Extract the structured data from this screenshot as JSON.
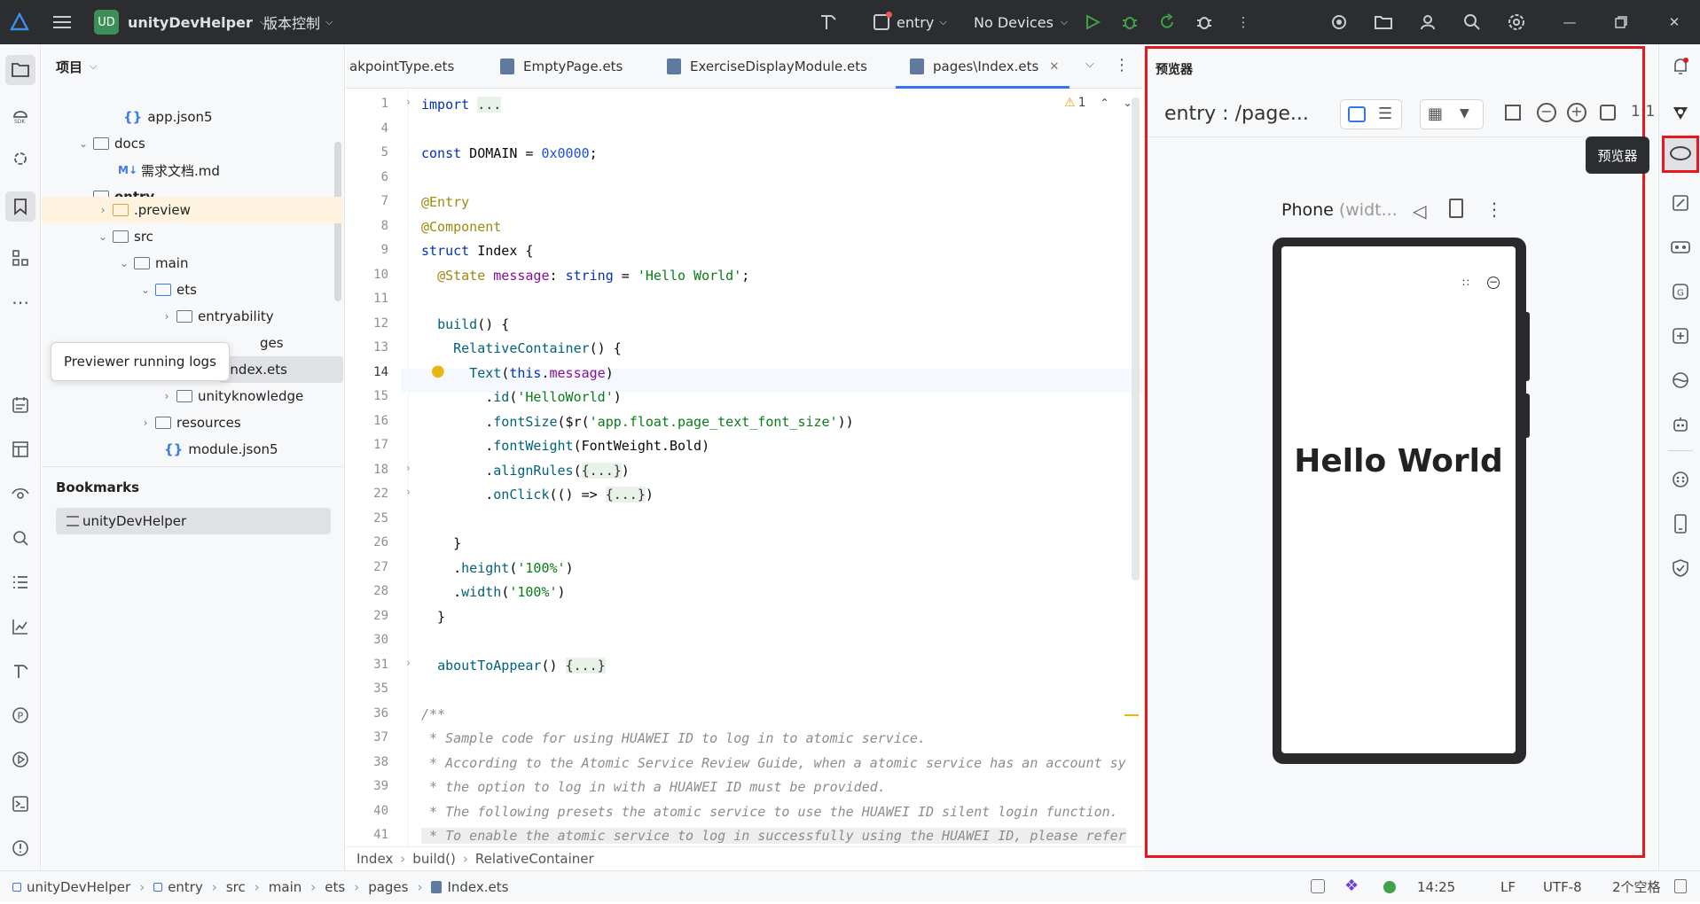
{
  "titlebar": {
    "project_badge": "UD",
    "project_name": "unityDevHelper",
    "vcs_menu": "版本控制",
    "run_config": "entry",
    "devices": "No Devices"
  },
  "project_panel": {
    "title": "项目",
    "tree": [
      {
        "label": "app.json5"
      },
      {
        "label": "docs"
      },
      {
        "label": "需求文档.md",
        "prefix": "M↓"
      },
      {
        "label": "entry"
      },
      {
        "label": ".preview"
      },
      {
        "label": "src"
      },
      {
        "label": "main"
      },
      {
        "label": "ets"
      },
      {
        "label": "entryability"
      },
      {
        "label": "ges"
      },
      {
        "label": "Index.ets"
      },
      {
        "label": "unityknowledge"
      },
      {
        "label": "resources"
      },
      {
        "label": "module.json5"
      }
    ],
    "bookmarks_title": "Bookmarks",
    "bookmark_item": "unityDevHelper",
    "tooltip": "Previewer running logs"
  },
  "tabs": [
    {
      "label": "akpointType.ets"
    },
    {
      "label": "EmptyPage.ets"
    },
    {
      "label": "ExerciseDisplayModule.ets"
    },
    {
      "label": "pages\\Index.ets"
    }
  ],
  "editor": {
    "warning_count": "1",
    "lines": [
      {
        "n": "1"
      },
      {
        "n": "4"
      },
      {
        "n": "5"
      },
      {
        "n": "6"
      },
      {
        "n": "7"
      },
      {
        "n": "8"
      },
      {
        "n": "9"
      },
      {
        "n": "10"
      },
      {
        "n": "11"
      },
      {
        "n": "12"
      },
      {
        "n": "13"
      },
      {
        "n": "14"
      },
      {
        "n": "15"
      },
      {
        "n": "16"
      },
      {
        "n": "17"
      },
      {
        "n": "18"
      },
      {
        "n": "22"
      },
      {
        "n": "25"
      },
      {
        "n": "26"
      },
      {
        "n": "27"
      },
      {
        "n": "28"
      },
      {
        "n": "29"
      },
      {
        "n": "30"
      },
      {
        "n": "31"
      },
      {
        "n": "35"
      },
      {
        "n": "36"
      },
      {
        "n": "37"
      },
      {
        "n": "38"
      },
      {
        "n": "39"
      },
      {
        "n": "40"
      },
      {
        "n": "41"
      }
    ],
    "comments": [
      "/**",
      " * Sample code for using HUAWEI ID to log in to atomic service.",
      " * According to the Atomic Service Review Guide, when a atomic service has an account sy",
      " * the option to log in with a HUAWEI ID must be provided.",
      " * The following presets the atomic service to use the HUAWEI ID silent login function.",
      " * To enable the atomic service to log in successfully using the HUAWEI ID, please refer"
    ]
  },
  "breadcrumb": [
    "Index",
    "build()",
    "RelativeContainer"
  ],
  "previewer": {
    "title": "预览器",
    "route": "entry : /page...",
    "ratio": "1:1",
    "device": "Phone",
    "device_hint": "(widt...",
    "hello": "Hello World",
    "tooltip": "预览器"
  },
  "statusbar": {
    "path": [
      "unityDevHelper",
      "entry",
      "src",
      "main",
      "ets",
      "pages",
      "Index.ets"
    ],
    "time": "14:25",
    "line_ending": "LF",
    "encoding": "UTF-8",
    "indent": "2个空格"
  },
  "colors": {
    "accent": "#3574f0",
    "red_box": "#e5181e",
    "titlebar_bg": "#2b2d30",
    "run_green": "#3fa24a"
  }
}
